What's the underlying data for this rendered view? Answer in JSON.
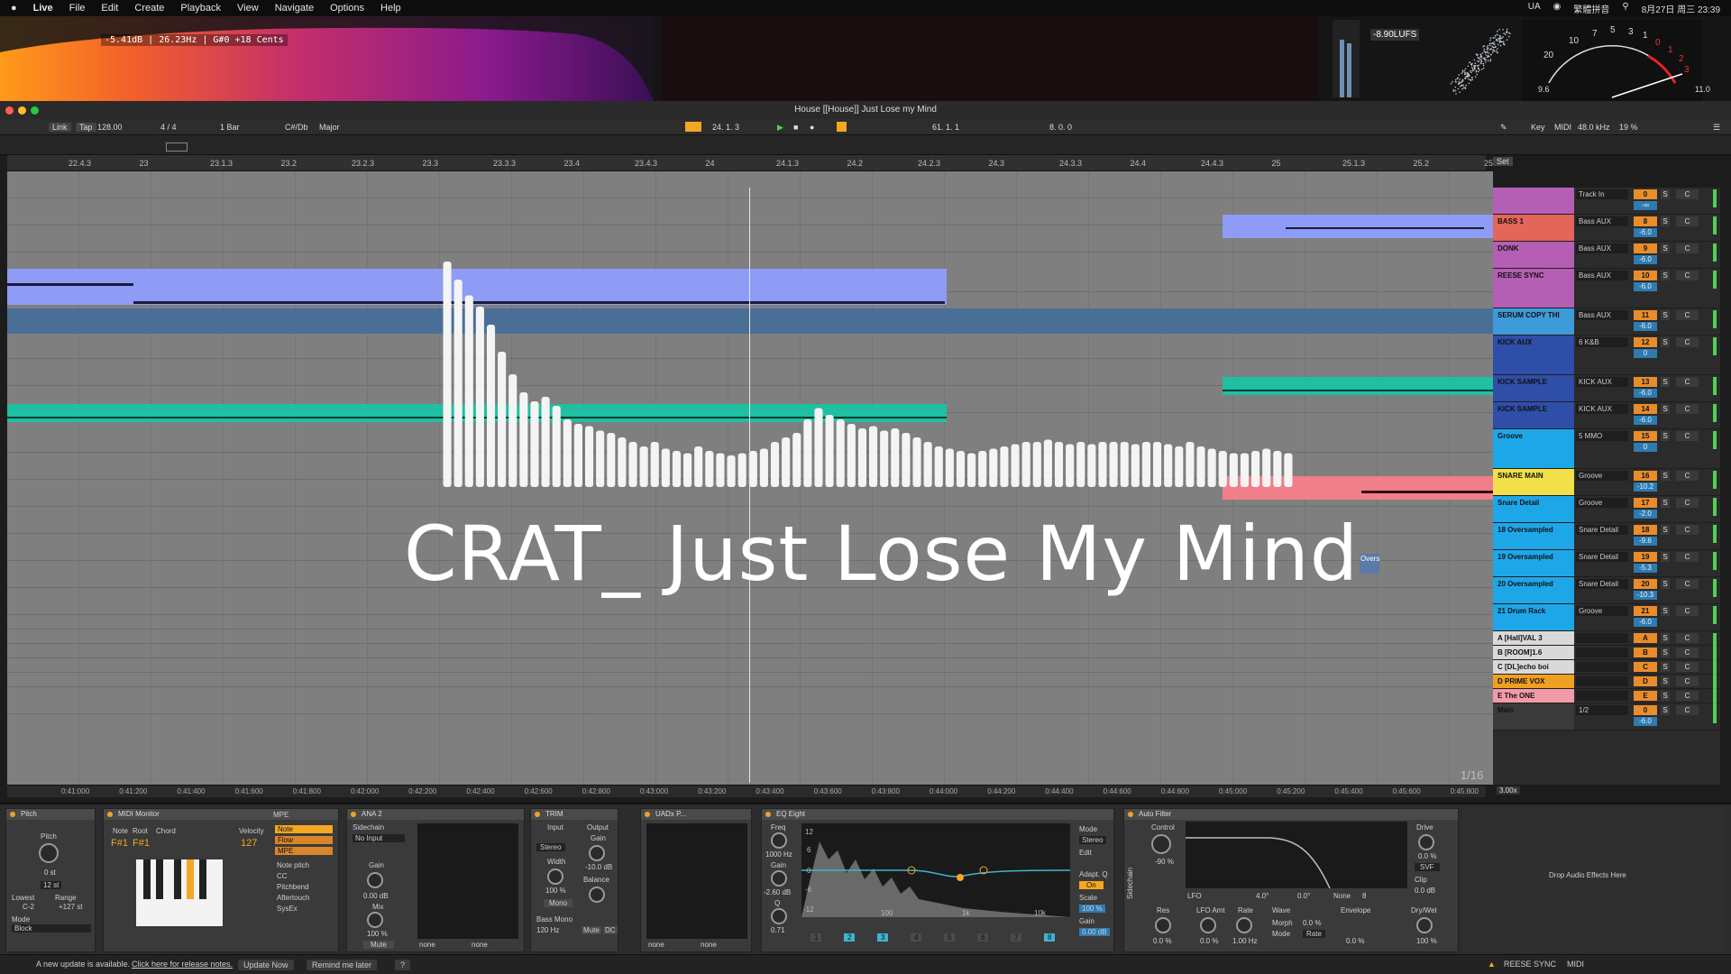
{
  "menubar": {
    "items": [
      "Live",
      "File",
      "Edit",
      "Create",
      "Playback",
      "View",
      "Navigate",
      "Options",
      "Help"
    ],
    "right": [
      "UA",
      "繁體拼音",
      "8月27日 周三 23:39"
    ]
  },
  "visualizer": {
    "spectrum_readout": "-5.41dB | 26.23Hz | G#0 +18 Cents",
    "lufs": "-8.90LUFS",
    "vu_left": "9.6",
    "vu_right": "11.0",
    "vu_scale": [
      "20",
      "10",
      "7",
      "5",
      "3",
      "1",
      "0",
      "1",
      "2",
      "3"
    ]
  },
  "window": {
    "title": "House [[House]] Just Lose my Mind"
  },
  "control_bar": {
    "link": "Link",
    "tap": "Tap",
    "tempo": "128.00",
    "signature": "4 / 4",
    "quantize": "1 Bar",
    "key": "C#/Db",
    "scale": "Major",
    "position": "24.  1.  3",
    "loop_start": "61.  1.  1",
    "loop_length": "8.  0.  0",
    "key_btn": "Key",
    "midi_btn": "MIDI",
    "sample_rate": "48.0 kHz",
    "cpu": "19 %"
  },
  "ruler": [
    "22.4.3",
    "23",
    "23.1.3",
    "23.2",
    "23.2.3",
    "23.3",
    "23.3.3",
    "23.4",
    "23.4.3",
    "24",
    "24.1.3",
    "24.2",
    "24.2.3",
    "24.3",
    "24.3.3",
    "24.4",
    "24.4.3",
    "25",
    "25.1.3",
    "25.2",
    "25.2.3"
  ],
  "ruler_set": "Set",
  "overlay": {
    "title": "CRAT_ Just Lose My Mind",
    "page": "1/16",
    "tag": "Overs"
  },
  "tracks": [
    {
      "name": "",
      "io": "Track In",
      "num": "0",
      "vol": "-∞",
      "color": "#b45fb4"
    },
    {
      "name": "BASS 1",
      "io": "Bass AUX",
      "num": "8",
      "vol": "-6.0",
      "color": "#e2665a"
    },
    {
      "name": "DONK",
      "io": "Bass AUX",
      "num": "9",
      "vol": "-6.0",
      "color": "#b45fb4"
    },
    {
      "name": "REESE SYNC",
      "io": "Bass AUX",
      "num": "10",
      "vol": "-6.0",
      "color": "#b45fb4"
    },
    {
      "name": "SERUM COPY THI",
      "io": "Bass AUX",
      "num": "11",
      "vol": "-6.0",
      "color": "#3f9ad9"
    },
    {
      "name": "KICK AUX",
      "io": "6 K&B",
      "num": "12",
      "vol": "0",
      "color": "#2f4ea8"
    },
    {
      "name": "KICK SAMPLE",
      "io": "KICK AUX",
      "num": "13",
      "vol": "-6.0",
      "color": "#2f4ea8"
    },
    {
      "name": "KICK SAMPLE",
      "io": "KICK AUX",
      "num": "14",
      "vol": "-6.0",
      "color": "#2f4ea8"
    },
    {
      "name": "Groove",
      "io": "5 MMO",
      "num": "15",
      "vol": "0",
      "color": "#1ea7e8"
    },
    {
      "name": "SNARE MAIN",
      "io": "Groove",
      "num": "16",
      "vol": "-10.2",
      "color": "#f1e04a"
    },
    {
      "name": "Snare Detail",
      "io": "Groove",
      "num": "17",
      "vol": "-2.0",
      "color": "#1ea7e8"
    },
    {
      "name": "18 Oversampled",
      "io": "Snare Detail",
      "num": "18",
      "vol": "-9.6",
      "color": "#1ea7e8"
    },
    {
      "name": "19 Oversampled",
      "io": "Snare Detail",
      "num": "19",
      "vol": "-5.3",
      "color": "#1ea7e8"
    },
    {
      "name": "20 Oversampled",
      "io": "Snare Detail",
      "num": "20",
      "vol": "-10.3",
      "color": "#1ea7e8"
    },
    {
      "name": "21 Drum Rack",
      "io": "Groove",
      "num": "21",
      "vol": "-6.0",
      "color": "#1ea7e8"
    },
    {
      "name": "A [Hall]VAL 3",
      "io": "",
      "num": "A",
      "vol": "",
      "color": "#d9d9d9"
    },
    {
      "name": "B [ROOM]1.6",
      "io": "",
      "num": "B",
      "vol": "",
      "color": "#d9d9d9"
    },
    {
      "name": "C [DL]echo boi",
      "io": "",
      "num": "C",
      "vol": "",
      "color": "#d9d9d9"
    },
    {
      "name": "D PRIME VOX",
      "io": "",
      "num": "D",
      "vol": "",
      "color": "#f0a020"
    },
    {
      "name": "E The ONE",
      "io": "",
      "num": "E",
      "vol": "",
      "color": "#f29aa8"
    },
    {
      "name": "Main",
      "io": "1/2",
      "num": "0",
      "vol": "-6.0",
      "color": "#3a3a3a"
    }
  ],
  "time_ruler": [
    "0:41:000",
    "0:41:200",
    "0:41:400",
    "0:41:600",
    "0:41:800",
    "0:42:000",
    "0:42:200",
    "0:42:400",
    "0:42:600",
    "0:42:800",
    "0:43:000",
    "0:43:200",
    "0:43:400",
    "0:43:600",
    "0:43:800",
    "0:44:000",
    "0:44:200",
    "0:44:400",
    "0:44:600",
    "0:44:800",
    "0:45:000",
    "0:45:200",
    "0:45:400",
    "0:45:600",
    "0:45:800"
  ],
  "zoom": "3.00x",
  "devices": {
    "pitch": {
      "title": "Pitch",
      "knob": "Pitch",
      "value": "0 st",
      "range_val": "12 st",
      "lowest": "Lowest",
      "lowest_val": "C-2",
      "range": "Range",
      "range_v": "+127 st",
      "mode": "Mode",
      "mode_val": "Block"
    },
    "midimon": {
      "title": "MIDI Monitor",
      "mpe": "MPE",
      "note": "Note",
      "root": "Root",
      "chord": "Chord",
      "velocity": "Velocity",
      "note_val": "F#1",
      "root_val": "F#1",
      "vel_val": "127",
      "opts": [
        "Note",
        "Flow",
        "MPE"
      ],
      "legend": [
        "Note pitch",
        "CC",
        "Pitchbend",
        "Aftertouch",
        "SysEx"
      ]
    },
    "ana2": {
      "title": "ANA 2",
      "sidechain": "Sidechain",
      "input": "No Input",
      "gain": "Gain",
      "gain_val": "0.00 dB",
      "mix": "Mix",
      "mix_val": "100 %",
      "mute": "Mute",
      "none1": "none",
      "none2": "none"
    },
    "trim": {
      "title": "TRIM",
      "input": "Input",
      "output": "Output",
      "stereo": "Stereo",
      "width": "Width",
      "width_val": "100 %",
      "gain": "Gain",
      "gain_val": "-10.0 dB",
      "balance": "Balance",
      "mono": "Mono",
      "bassmono": "Bass Mono",
      "hz": "120 Hz",
      "mute": "Mute",
      "dc": "DC"
    },
    "uadx": {
      "title": "UADx P...",
      "none1": "none",
      "none2": "none"
    },
    "eq": {
      "title": "EQ Eight",
      "freq": "Freq",
      "freq_val": "1000 Hz",
      "gain": "Gain",
      "gain_val": "-2.60 dB",
      "q": "Q",
      "q_val": "0.71",
      "mode": "Mode",
      "stereo": "Stereo",
      "edit": "Edit",
      "adapt": "Adapt. Q",
      "on": "On",
      "scale": "Scale",
      "scale_val": "100 %",
      "out": "Gain",
      "out_val": "0.00 dB",
      "axis": [
        "100",
        "1k",
        "10k"
      ],
      "db": [
        "12",
        "6",
        "0",
        "-6",
        "-12"
      ],
      "bands": [
        "1",
        "2",
        "3",
        "4",
        "5",
        "6",
        "7",
        "8"
      ]
    },
    "af": {
      "title": "Auto Filter",
      "control": "Control",
      "ctrl_val": "-90 %",
      "drive": "Drive",
      "drive_val": "0.0 %",
      "svf": "SVF",
      "clip": "Clip",
      "out": "0.0 dB",
      "res": "Res",
      "res_val": "0.0 %",
      "lfo": "LFO",
      "lfoamt": "LFO Amt",
      "lfoamt_val": "0.0 %",
      "rate": "Rate",
      "rate_val": "1.00 Hz",
      "wave": "Wave",
      "morph": "Morph",
      "morph_val": "0.0 %",
      "mode": "Mode",
      "mode_val": "Rate",
      "env": "Envelope",
      "env_val": "0.0 %",
      "dw": "Dry/Wet",
      "dw_val": "100 %",
      "phase": "4.0°",
      "off": "0.0°",
      "none": "None",
      "eight": "8",
      "sidechain": "Sidechain"
    },
    "drop": "Drop Audio Effects Here"
  },
  "status": {
    "msg": "A new update is available.",
    "link": "Click here for release notes.",
    "update": "Update Now",
    "remind": "Remind me later",
    "q": "?",
    "track": "REESE SYNC",
    "midi": "MIDI"
  },
  "colors": {
    "accent": "#f5a623",
    "clip_blue": "#8e9cf5",
    "clip_teal": "#1fbfa1",
    "clip_pink": "#f07f8a",
    "clip_slate": "#4a6f96"
  },
  "visualizer_levels": [
    1.0,
    0.92,
    0.85,
    0.8,
    0.72,
    0.6,
    0.5,
    0.42,
    0.38,
    0.4,
    0.36,
    0.3,
    0.28,
    0.27,
    0.25,
    0.24,
    0.22,
    0.2,
    0.18,
    0.2,
    0.17,
    0.16,
    0.15,
    0.18,
    0.16,
    0.15,
    0.14,
    0.15,
    0.16,
    0.17,
    0.2,
    0.22,
    0.24,
    0.3,
    0.35,
    0.32,
    0.3,
    0.28,
    0.26,
    0.27,
    0.25,
    0.26,
    0.24,
    0.22,
    0.2,
    0.18,
    0.17,
    0.16,
    0.15,
    0.16,
    0.17,
    0.18,
    0.19,
    0.2,
    0.2,
    0.21,
    0.2,
    0.19,
    0.2,
    0.19,
    0.2,
    0.2,
    0.2,
    0.19,
    0.2,
    0.2,
    0.19,
    0.18,
    0.2,
    0.18,
    0.17,
    0.16,
    0.15,
    0.15,
    0.16,
    0.17,
    0.16,
    0.15
  ]
}
